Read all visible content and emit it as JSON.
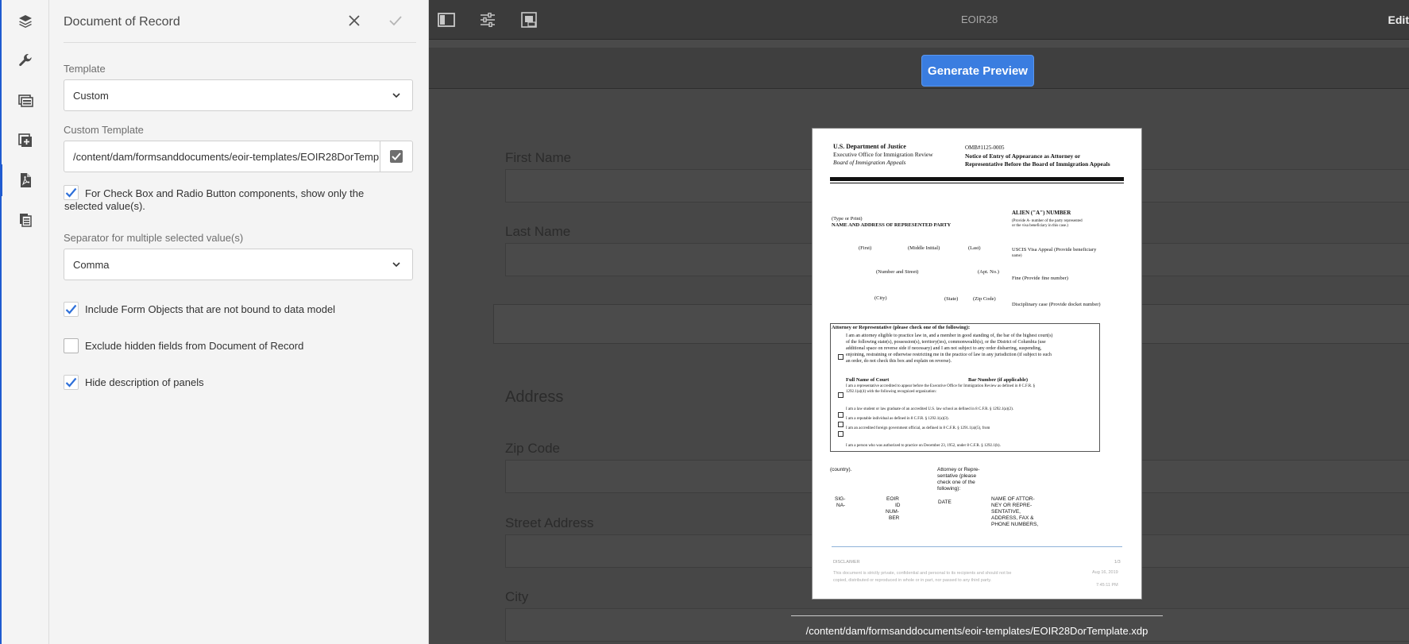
{
  "rail": {
    "items": [
      "layers-icon",
      "wrench-icon",
      "form-container-icon",
      "add-fragment-icon",
      "pdf-document-icon",
      "documents-icon"
    ]
  },
  "panel": {
    "title": "Document of Record",
    "template_label": "Template",
    "template_value": "Custom",
    "custom_template_label": "Custom Template",
    "custom_template_value": "/content/dam/formsanddocuments/eoir-templates/EOIR28DorTemplate.xdp",
    "checkbox_only_selected": {
      "label": "For Check Box and Radio Button components, show only the selected value(s).",
      "checked": true
    },
    "separator_label": "Separator for multiple selected value(s)",
    "separator_value": "Comma",
    "include_unbound": {
      "label": "Include Form Objects that are not bound to data model",
      "checked": true
    },
    "exclude_hidden": {
      "label": "Exclude hidden fields from Document of Record",
      "checked": false
    },
    "hide_panel_desc": {
      "label": "Hide description of panels",
      "checked": true
    }
  },
  "toolbar": {
    "title": "EOIR28",
    "edit_label": "Edit"
  },
  "preview": {
    "generate_label": "Generate Preview",
    "path": "/content/dam/formsanddocuments/eoir-templates/EOIR28DorTemplate.xdp"
  },
  "form": {
    "first_name": "First Name",
    "last_name": "Last Name",
    "address": "Address",
    "zip_code": "Zip Code",
    "street_address": "Street Address",
    "city": "City"
  },
  "pdf": {
    "dept": "U.S. Department of Justice",
    "office": "Executive Office for Immigration Review",
    "board": "Board of Immigration Appeals",
    "omb": "OMB#1125-0005",
    "notice_1": "Notice of Entry of Appearance as Attorney or",
    "notice_2": "Representative Before the Board of Immigration Appeals",
    "type_or_print": "(Type or Print)",
    "name_address": "NAME AND ADDRESS OF REPRESENTED PARTY",
    "alien_number": "ALIEN (\"A\") NUMBER",
    "alien_note_1": "(Provide A- number of the party represented",
    "alien_note_2": "or the visa beneficiary in this case.)",
    "first": "(First)",
    "middle": "(Middle Initial)",
    "last": "(Last)",
    "uscis_1": "USCIS Visa Appeal (Provide beneficiary",
    "uscis_2": "name)",
    "number_street": "(Number and Street)",
    "apt": "(Apt. No.)",
    "fine": "Fine (Provide fine number)",
    "city": "(City)",
    "state": "(State)",
    "zip": "(Zip Code)",
    "disciplinary": "Disciplinary case (Provide docket number)",
    "attorney_header": "Attorney or Representative (please check one of the following):",
    "attorney_text_1": "I am an attorney eligible to practice law in, and a member in good standing of, the bar of the highest court(s)",
    "attorney_text_2": "of the following state(s), possession(s), territory(ies), commonwealth(s), or the District of Columbia (use",
    "attorney_text_3": "additional space on reverse side if necessary) and I am not subject to any order disbarring, suspending,",
    "attorney_text_4": "enjoining, restraining or otherwise restricting me in the practice of law in any jurisdiction (if subject to such",
    "attorney_text_5": "an order, do not check this box and explain on reverse).",
    "full_name_court": "Full Name of Court",
    "bar_number": "Bar Number (if applicable)",
    "rep_1": "I am a representative accredited to appear before the Executive Office for Immigration Review as defined in 8 C.F.R. §",
    "rep_2": "1292.1(a)(4) with the following recognized organization:",
    "law_student": "I am a law student or law graduate of an accredited U.S. law school as defined in 8 C.F.R. § 1292.1(a)(2).",
    "reputable": "I am a reputable individual as defined in 8 C.F.R. § 1292.1(a)(3).",
    "foreign_official": "I am an accredited foreign government official, as defined in 8 C.F.R. § 1291.1(a)(5), from",
    "authorized": "I am a person who was authorized to practice on December 23, 1952, under 8 C.F.R. § 1292.1(b).",
    "country": "(country).",
    "attorney_rep_1": "Attorney or Repre-",
    "attorney_rep_2": "sentative (please",
    "attorney_rep_3": "check one of the",
    "attorney_rep_4": "following):",
    "sig_1": "SIG-",
    "sig_2": "NA-",
    "eoir_1": "EOIR",
    "eoir_2": "ID",
    "eoir_3": "NUM-",
    "eoir_4": "BER",
    "date": "DATE",
    "name_attor_1": "NAME OF ATTOR-",
    "name_attor_2": "NEY OR REPRE-",
    "name_attor_3": "SENTATIVE,",
    "name_attor_4": "ADDRESS, FAX &",
    "name_attor_5": "PHONE NUMBERS,",
    "disclaimer": "DISCLAIMER",
    "page": "1/3",
    "disclaimer_text_1": "This document is strictly private, confidential and personal to its recipients and should not be",
    "disclaimer_text_2": "copied, distributed or reproduced in whole or in part, nor passed to any third party.",
    "date_stamp": "Aug 16, 2019",
    "time_stamp": "7:45:11 PM"
  }
}
